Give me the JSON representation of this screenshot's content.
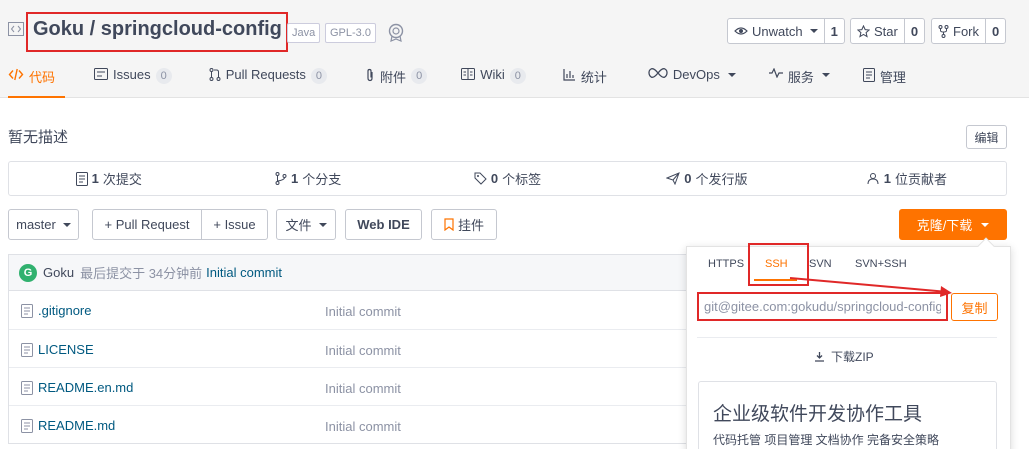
{
  "repo": {
    "title": "Goku / springcloud-config",
    "tags": [
      "Java",
      "GPL-3.0"
    ]
  },
  "header_actions": {
    "unwatch": {
      "label": "Unwatch",
      "count": "1"
    },
    "star": {
      "label": "Star",
      "count": "0"
    },
    "fork": {
      "label": "Fork",
      "count": "0"
    }
  },
  "tabs": [
    {
      "label": "代码",
      "badge": ""
    },
    {
      "label": "Issues",
      "badge": "0"
    },
    {
      "label": "Pull Requests",
      "badge": "0"
    },
    {
      "label": "附件",
      "badge": "0"
    },
    {
      "label": "Wiki",
      "badge": "0"
    },
    {
      "label": "统计",
      "badge": ""
    },
    {
      "label": "DevOps",
      "badge": ""
    },
    {
      "label": "服务",
      "badge": ""
    },
    {
      "label": "管理",
      "badge": ""
    }
  ],
  "description": "暂无描述",
  "edit_label": "编辑",
  "stats": [
    {
      "count": "1",
      "label": "次提交"
    },
    {
      "count": "1",
      "label": "个分支"
    },
    {
      "count": "0",
      "label": "个标签"
    },
    {
      "count": "0",
      "label": "个发行版"
    },
    {
      "count": "1",
      "label": "位贡献者"
    }
  ],
  "toolbar": {
    "branch": "master",
    "pull_request": "+ Pull Request",
    "issue": "+ Issue",
    "files": "文件",
    "web_ide": "Web IDE",
    "widget": "挂件",
    "clone": "克隆/下载"
  },
  "commit": {
    "avatar_letter": "G",
    "author": "Goku",
    "meta": "最后提交于 34分钟前",
    "message": "Initial commit"
  },
  "files": [
    {
      "name": ".gitignore",
      "message": "Initial commit"
    },
    {
      "name": "LICENSE",
      "message": "Initial commit"
    },
    {
      "name": "README.en.md",
      "message": "Initial commit"
    },
    {
      "name": "README.md",
      "message": "Initial commit"
    }
  ],
  "clone_popover": {
    "protocols": [
      "HTTPS",
      "SSH",
      "SVN",
      "SVN+SSH"
    ],
    "url": "git@gitee.com:gokudu/springcloud-config.git",
    "copy": "复制",
    "download_zip": "下载ZIP",
    "ad_title": "企业级软件开发协作工具",
    "ad_subtitle": "代码托管 项目管理 文档协作 完备安全策略"
  },
  "colors": {
    "accent": "#fe7300",
    "annotation": "#e02828",
    "link": "#005980"
  }
}
